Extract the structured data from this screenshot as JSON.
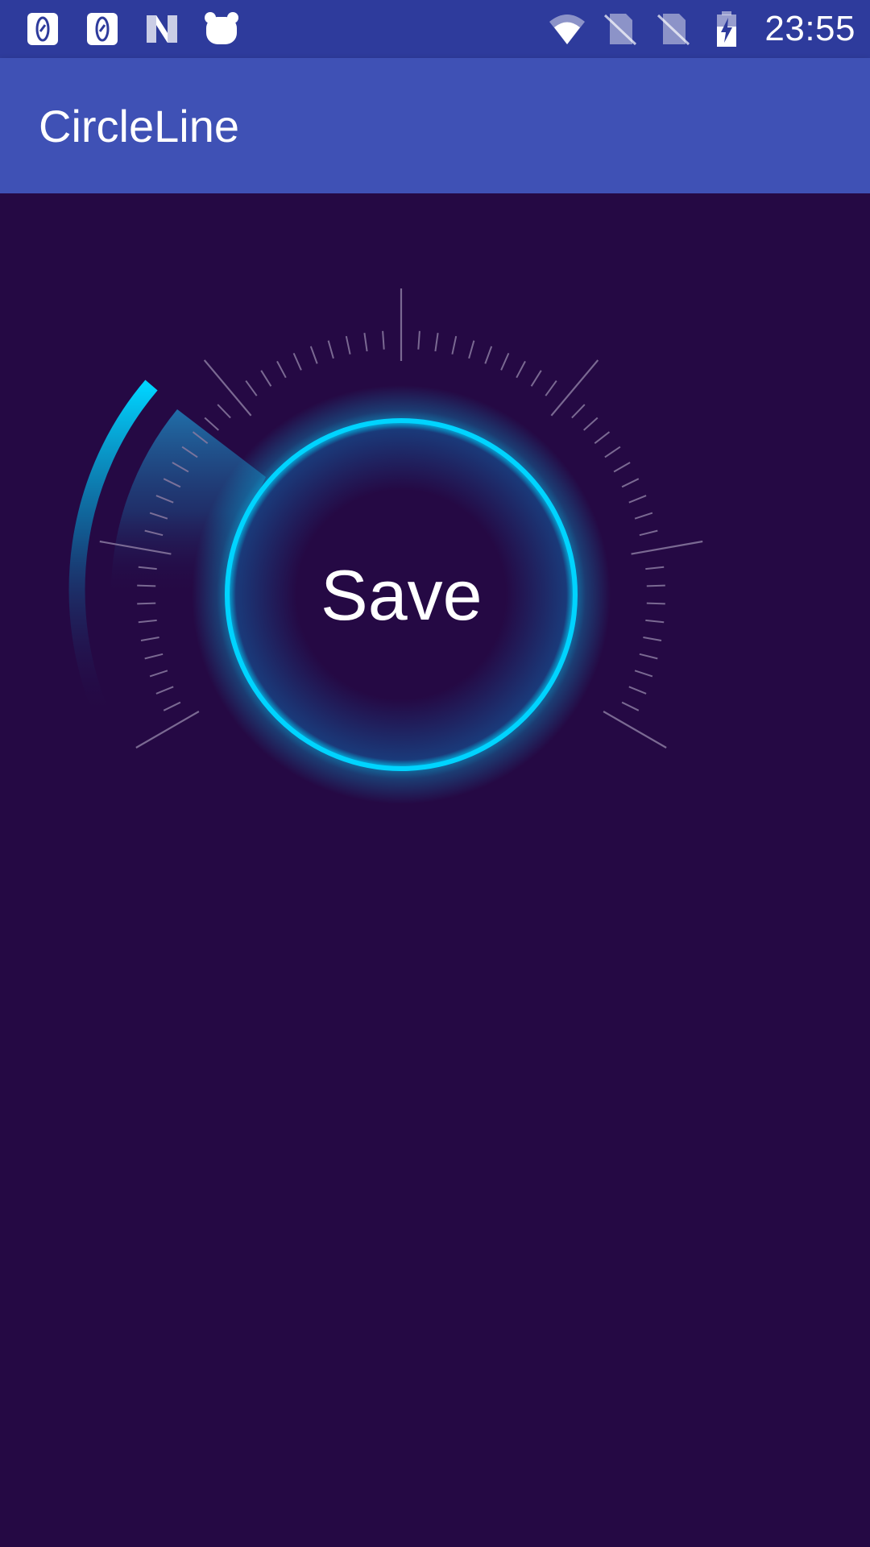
{
  "status_bar": {
    "time": "23:55",
    "left_icons": [
      "sim-card-icon",
      "sim-card-icon",
      "nova-launcher-icon",
      "bear-app-icon"
    ],
    "right_icons": [
      "wifi-icon",
      "no-sim-icon",
      "no-sim-icon",
      "battery-charging-icon"
    ]
  },
  "app_bar": {
    "title": "CircleLine"
  },
  "dial": {
    "button_label": "Save",
    "accent_color": "#00D4FF",
    "tick_color": "#8A7AA0",
    "background_color": "#250944"
  }
}
